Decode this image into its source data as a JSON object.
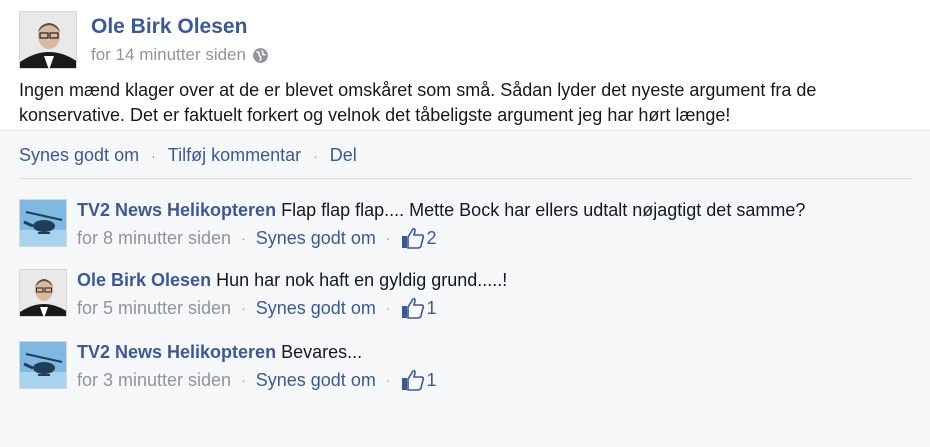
{
  "post": {
    "author": "Ole Birk Olesen",
    "time": "for 14 minutter siden",
    "privacy_icon": "globe-icon",
    "text": "Ingen mænd klager over at de er blevet omskåret som små. Sådan lyder det nyeste argument fra de konservative. Det er faktuelt forkert og velnok det tåbeligste argument jeg har hørt længe!"
  },
  "actions": {
    "like": "Synes godt om",
    "comment": "Tilføj kommentar",
    "share": "Del",
    "separator": "·"
  },
  "comments": [
    {
      "author": "TV2 News Helikopteren",
      "text": "Flap flap flap....  Mette Bock har ellers udtalt nøjagtigt det samme?",
      "time": "for 8 minutter siden",
      "like_label": "Synes godt om",
      "likes": "2",
      "avatar": "helicopter"
    },
    {
      "author": "Ole Birk Olesen",
      "text": "Hun har nok haft en gyldig grund.....!",
      "time": "for 5 minutter siden",
      "like_label": "Synes godt om",
      "likes": "1",
      "avatar": "person"
    },
    {
      "author": "TV2 News Helikopteren",
      "text": "Bevares...",
      "time": "for 3 minutter siden",
      "like_label": "Synes godt om",
      "likes": "1",
      "avatar": "helicopter"
    }
  ],
  "colors": {
    "link": "#3b5998",
    "meta": "#90949c",
    "panel_bg": "#f6f7f9"
  }
}
